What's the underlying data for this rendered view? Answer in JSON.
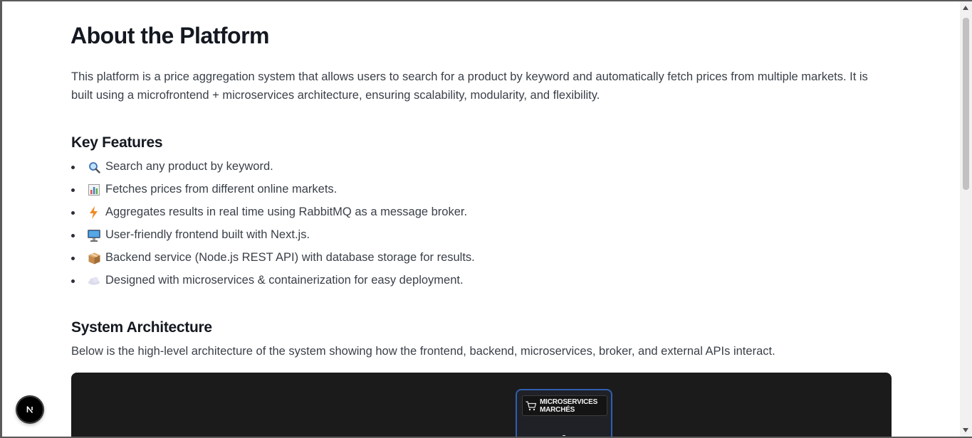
{
  "page": {
    "title": "About the Platform",
    "intro": "This platform is a price aggregation system that allows users to search for a product by keyword and automatically fetch prices from multiple markets. It is built using a microfrontend + microservices architecture, ensuring scalability, modularity, and flexibility."
  },
  "features": {
    "heading": "Key Features",
    "items": [
      {
        "icon": "magnifier-icon",
        "text": "Search any product by keyword."
      },
      {
        "icon": "bar-chart-icon",
        "text": "Fetches prices from different online markets."
      },
      {
        "icon": "lightning-icon",
        "text": "Aggregates results in real time using RabbitMQ as a message broker."
      },
      {
        "icon": "desktop-computer-icon",
        "text": "User-friendly frontend built with Next.js."
      },
      {
        "icon": "package-icon",
        "text": "Backend service (Node.js REST API) with database storage for results."
      },
      {
        "icon": "cloud-icon",
        "text": "Designed with microservices & containerization for easy deployment."
      }
    ]
  },
  "architecture": {
    "heading": "System Architecture",
    "description": "Below is the high-level architecture of the system showing how the frontend, backend, microservices, broker, and external APIs interact.",
    "diagram": {
      "node_label_line1": "MICROSERVICES",
      "node_label_line2": "MARCHÉS",
      "node_icon": "shopping-cart-icon",
      "colors": {
        "background": "#1b1b1b",
        "node_border": "#2f5fb0"
      }
    }
  },
  "dev_badge": {
    "label": "N",
    "icon": "nextjs-logo-icon"
  }
}
